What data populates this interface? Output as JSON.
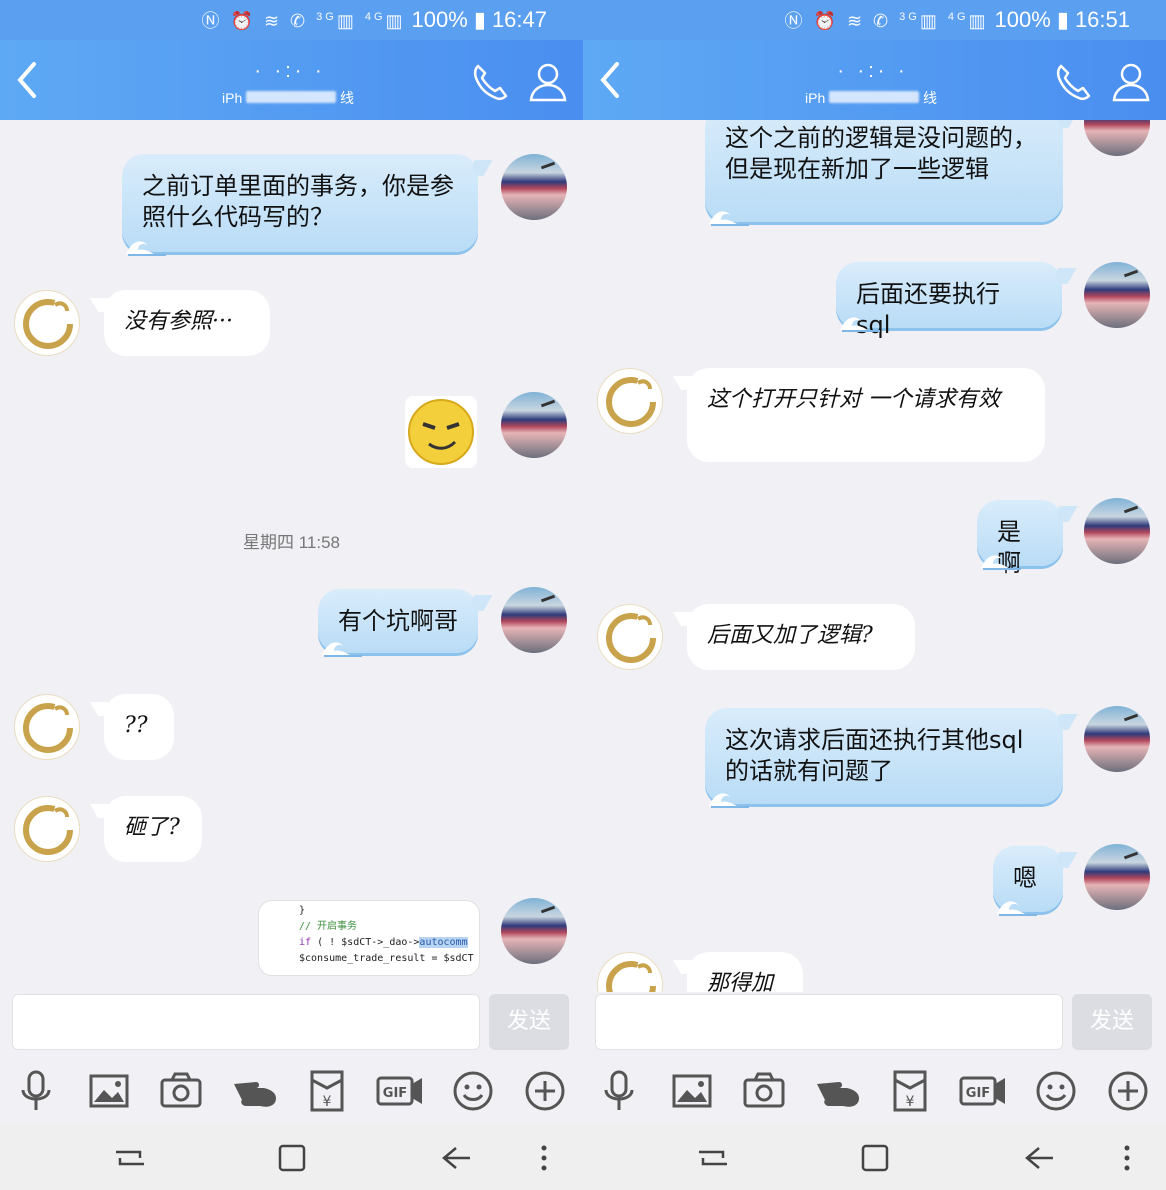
{
  "colors": {
    "titlebar": "#4a8ef0",
    "bubble_me": "#c6e2f8",
    "bubble_other": "#ffffff",
    "chat_bg": "#f0f0f5",
    "avatar_other_gold": "#c9a34b"
  },
  "icons": [
    "back-arrow-icon",
    "phone-icon",
    "person-icon",
    "microphone-icon",
    "image-icon",
    "camera-icon",
    "pointing-hand-icon",
    "red-packet-icon",
    "gif-icon",
    "smiley-icon",
    "plus-icon",
    "recent-apps-icon",
    "home-icon",
    "back-nav-icon",
    "more-icon"
  ],
  "left": {
    "status": {
      "battery": "100%",
      "time": "16:47",
      "net1": "3G",
      "net2": "4G"
    },
    "header": {
      "name": "·  ·:·  ·",
      "sub_prefix": "iPh",
      "sub_suffix": "线"
    },
    "messages": {
      "m1": "之前订单里面的事务，你是参照什么代码写的？",
      "m2": "没有参照···",
      "time": "星期四 11:58",
      "m3": "有个坑啊哥",
      "m4": "??",
      "m5": "砸了?"
    },
    "code": {
      "line1": "}",
      "line2": "// 开启事务",
      "line3_kw": "if",
      "line3_rest": " ( ! $sdCT->_dao->",
      "line3_hl": "autocomm",
      "line4": "$consume_trade_result = $sdCT"
    },
    "input": {
      "placeholder": "",
      "send": "发送"
    }
  },
  "right": {
    "status": {
      "battery": "100%",
      "time": "16:51",
      "net1": "3G",
      "net2": "4G"
    },
    "header": {
      "name": "·  ·:·  ·",
      "sub_prefix": "iPh",
      "sub_suffix": "线"
    },
    "messages": {
      "m1": "这个之前的逻辑是没问题的，但是现在新加了一些逻辑",
      "m2": "后面还要执行 sql",
      "m3": "这个打开只针对 一个请求有效",
      "m4": "是啊",
      "m5": "后面又加了逻辑?",
      "m6": "这次请求后面还执行其他sql的话就有问题了",
      "m7": "嗯",
      "m8": "那得加"
    },
    "input": {
      "placeholder": "",
      "send": "发送"
    }
  }
}
